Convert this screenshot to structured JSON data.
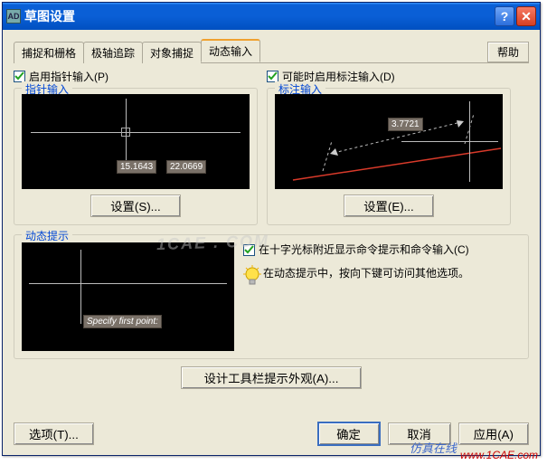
{
  "titlebar": {
    "icon_text": "AD",
    "title": "草图设置",
    "help_symbol": "?",
    "close_symbol": "✕"
  },
  "tabs": [
    {
      "label": "捕捉和栅格"
    },
    {
      "label": "极轴追踪"
    },
    {
      "label": "对象捕捉"
    },
    {
      "label": "动态输入"
    }
  ],
  "help_button": "帮助",
  "pointer": {
    "checkbox_label": "启用指针输入(P)",
    "legend": "指针输入",
    "value1": "15.1643",
    "value2": "22.0669",
    "settings_button": "设置(S)..."
  },
  "dimension": {
    "checkbox_label": "可能时启用标注输入(D)",
    "legend": "标注输入",
    "value": "3.7721",
    "settings_button": "设置(E)..."
  },
  "dynamic": {
    "legend": "动态提示",
    "prompt_text": "Specify first point:",
    "checkbox_label": "在十字光标附近显示命令提示和命令输入(C)",
    "tip_text": "在动态提示中，按向下键可访问其他选项。"
  },
  "appearance_button": "设计工具栏提示外观(A)...",
  "footer_buttons": {
    "options": "选项(T)...",
    "ok": "确定",
    "cancel": "取消",
    "apply": "应用(A)"
  },
  "watermarks": {
    "center": "1CAE . COM",
    "slogan": "仿真在线",
    "url": "www.1CAE.com"
  }
}
